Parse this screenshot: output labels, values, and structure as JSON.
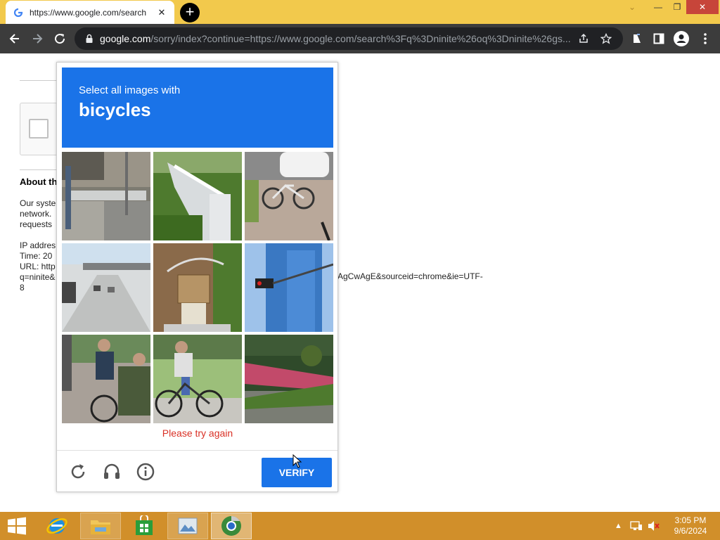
{
  "browser": {
    "tab_title": "https://www.google.com/search",
    "url_host": "google.com",
    "url_rest": "/sorry/index?continue=https://www.google.com/search%3Fq%3Dninite%26oq%3Dninite%26gs..."
  },
  "page": {
    "about_title": "About th",
    "para1": [
      "Our syste",
      "network.",
      "requests"
    ],
    "para2": [
      "IP addres",
      "Time: 20",
      "URL: http",
      "q=ninite&",
      "8"
    ],
    "url_tail": "AgCwAgE&sourceid=chrome&ie=UTF-"
  },
  "captcha": {
    "instruction": "Select all images with",
    "target": "bicycles",
    "tiles": [
      "street-tile",
      "bridge-tile",
      "parked-bicycle-tile",
      "highway-tile",
      "basket-bicycle-tile",
      "traffic-light-tile",
      "cyclists-tile",
      "cyclist-tile",
      "garden-tile"
    ],
    "error_message": "Please try again",
    "verify_label": "VERIFY"
  },
  "taskbar": {
    "time": "3:05 PM",
    "date": "9/6/2024"
  },
  "colors": {
    "accent": "#1a73e8",
    "error": "#d93025",
    "titlebar": "#f2c94c",
    "taskbar": "#d18f2a"
  }
}
